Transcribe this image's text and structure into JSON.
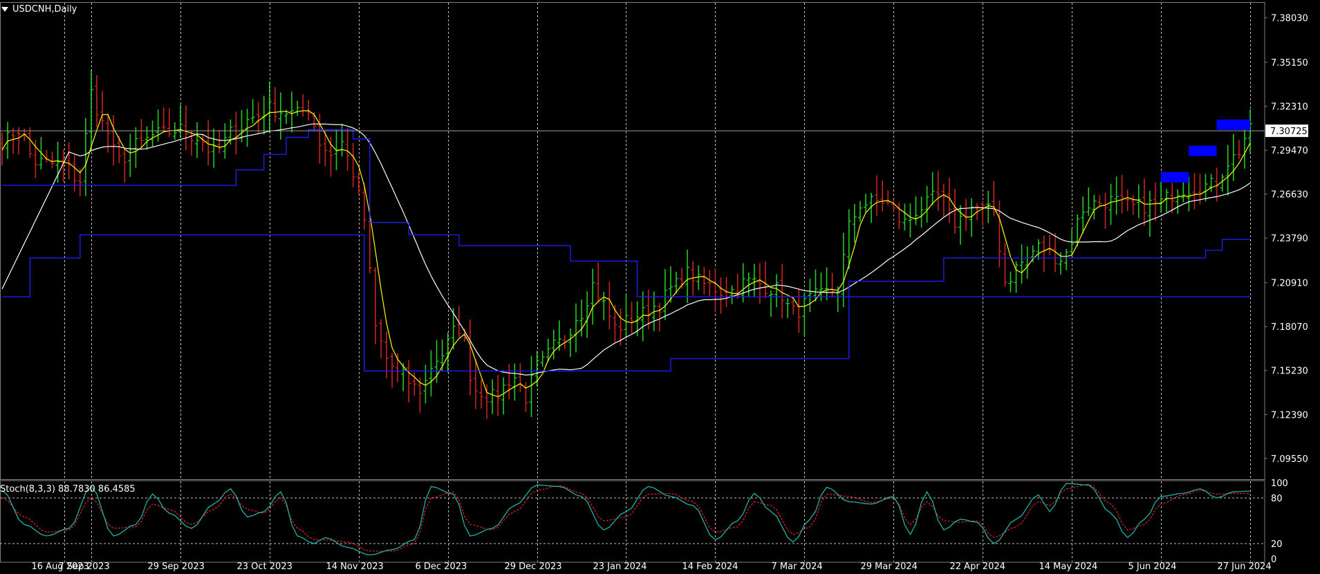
{
  "window": {
    "symbol_title": "USDCNH,Daily",
    "stoch_title": "Stoch(8,3,3) 88.7830 86.4585"
  },
  "colors": {
    "background": "#000000",
    "bull_candle": "#22cc22",
    "bear_candle": "#cc2222",
    "fast_ma": "#ffff00",
    "slow_ma": "#ffffff",
    "channel": "#1e1ef0",
    "blocks": "#0000ff",
    "stoch_main": "#20b2aa",
    "stoch_signal": "#ff2020",
    "grid": "#c0c0c0"
  },
  "chart_data": [
    {
      "type": "candlestick",
      "title": "USDCNH,Daily",
      "ylim": [
        7.082,
        7.39
      ],
      "price_ticks": [
        "7.38030",
        "7.35150",
        "7.32310",
        "7.29470",
        "7.26630",
        "7.23790",
        "7.20910",
        "7.18070",
        "7.15230",
        "7.12390",
        "7.09550"
      ],
      "current_price": "7.30725",
      "x_tick_labels": [
        "16 Aug 2023",
        "7 Sep 2023",
        "29 Sep 2023",
        "23 Oct 2023",
        "14 Nov 2023",
        "6 Dec 2023",
        "29 Dec 2023",
        "23 Jan 2024",
        "14 Feb 2024",
        "7 Mar 2024",
        "29 Mar 2024",
        "22 Apr 2024",
        "14 May 2024",
        "5 Jun 2024",
        "27 Jun 2024"
      ],
      "x_tick_bars": [
        0,
        16,
        32,
        48,
        64,
        80,
        96,
        112,
        128,
        144,
        160,
        176,
        192,
        208,
        224
      ],
      "bar_count": 225,
      "close_anchors": [
        [
          0,
          7.3
        ],
        [
          3,
          7.308
        ],
        [
          6,
          7.287
        ],
        [
          11,
          7.285
        ],
        [
          14,
          7.275
        ],
        [
          16,
          7.332
        ],
        [
          18,
          7.312
        ],
        [
          21,
          7.288
        ],
        [
          24,
          7.298
        ],
        [
          28,
          7.305
        ],
        [
          32,
          7.308
        ],
        [
          35,
          7.303
        ],
        [
          38,
          7.293
        ],
        [
          42,
          7.308
        ],
        [
          45,
          7.316
        ],
        [
          48,
          7.322
        ],
        [
          50,
          7.32
        ],
        [
          53,
          7.318
        ],
        [
          55,
          7.322
        ],
        [
          57,
          7.3
        ],
        [
          59,
          7.292
        ],
        [
          61,
          7.3
        ],
        [
          63,
          7.28
        ],
        [
          65,
          7.25
        ],
        [
          67,
          7.18
        ],
        [
          69,
          7.16
        ],
        [
          71,
          7.15
        ],
        [
          75,
          7.14
        ],
        [
          78,
          7.16
        ],
        [
          82,
          7.18
        ],
        [
          85,
          7.14
        ],
        [
          88,
          7.135
        ],
        [
          92,
          7.148
        ],
        [
          94,
          7.135
        ],
        [
          96,
          7.155
        ],
        [
          100,
          7.17
        ],
        [
          104,
          7.19
        ],
        [
          106,
          7.208
        ],
        [
          108,
          7.195
        ],
        [
          110,
          7.18
        ],
        [
          114,
          7.188
        ],
        [
          118,
          7.195
        ],
        [
          120,
          7.205
        ],
        [
          123,
          7.215
        ],
        [
          126,
          7.208
        ],
        [
          130,
          7.203
        ],
        [
          134,
          7.21
        ],
        [
          139,
          7.205
        ],
        [
          142,
          7.19
        ],
        [
          146,
          7.2
        ],
        [
          150,
          7.205
        ],
        [
          152,
          7.245
        ],
        [
          154,
          7.26
        ],
        [
          158,
          7.262
        ],
        [
          162,
          7.248
        ],
        [
          165,
          7.258
        ],
        [
          168,
          7.265
        ],
        [
          171,
          7.248
        ],
        [
          174,
          7.258
        ],
        [
          178,
          7.255
        ],
        [
          180,
          7.21
        ],
        [
          183,
          7.222
        ],
        [
          186,
          7.232
        ],
        [
          190,
          7.225
        ],
        [
          195,
          7.26
        ],
        [
          199,
          7.262
        ],
        [
          203,
          7.258
        ],
        [
          207,
          7.26
        ],
        [
          212,
          7.27
        ],
        [
          217,
          7.272
        ],
        [
          221,
          7.29
        ],
        [
          224,
          7.307
        ]
      ],
      "channel_upper_steps": [
        [
          0,
          7.272
        ],
        [
          42,
          7.282
        ],
        [
          47,
          7.292
        ],
        [
          51,
          7.303
        ],
        [
          55,
          7.308
        ],
        [
          63,
          7.302
        ],
        [
          66,
          7.248
        ],
        [
          73,
          7.24
        ],
        [
          82,
          7.233
        ],
        [
          102,
          7.223
        ],
        [
          114,
          7.2
        ],
        [
          224,
          7.2
        ]
      ],
      "channel_lower_steps": [
        [
          0,
          7.2
        ],
        [
          5,
          7.225
        ],
        [
          14,
          7.24
        ],
        [
          65,
          7.152
        ],
        [
          120,
          7.16
        ],
        [
          148,
          7.16
        ],
        [
          152,
          7.21
        ],
        [
          166,
          7.21
        ],
        [
          169,
          7.225
        ],
        [
          210,
          7.225
        ],
        [
          216,
          7.23
        ],
        [
          219,
          7.237
        ]
      ],
      "blocks": [
        [
          208,
          213,
          7.277
        ],
        [
          213,
          218,
          7.294
        ],
        [
          218,
          224,
          7.311
        ]
      ]
    },
    {
      "type": "line",
      "title": "Stoch(8,3,3) 88.7830 86.4585",
      "ylim": [
        0,
        100
      ],
      "y_ticks": [
        "100",
        "80",
        "20",
        "0"
      ],
      "series": [
        {
          "key": "main",
          "anchors": [
            [
              0,
              90
            ],
            [
              4,
              45
            ],
            [
              8,
              30
            ],
            [
              12,
              40
            ],
            [
              16,
              95
            ],
            [
              20,
              30
            ],
            [
              24,
              45
            ],
            [
              27,
              85
            ],
            [
              30,
              60
            ],
            [
              34,
              40
            ],
            [
              38,
              72
            ],
            [
              41,
              92
            ],
            [
              44,
              55
            ],
            [
              47,
              62
            ],
            [
              50,
              88
            ],
            [
              53,
              30
            ],
            [
              56,
              20
            ],
            [
              58,
              28
            ],
            [
              62,
              15
            ],
            [
              66,
              5
            ],
            [
              70,
              12
            ],
            [
              74,
              25
            ],
            [
              77,
              95
            ],
            [
              81,
              85
            ],
            [
              84,
              30
            ],
            [
              88,
              40
            ],
            [
              92,
              70
            ],
            [
              96,
              97
            ],
            [
              100,
              95
            ],
            [
              104,
              82
            ],
            [
              108,
              38
            ],
            [
              112,
              62
            ],
            [
              116,
              95
            ],
            [
              120,
              82
            ],
            [
              124,
              70
            ],
            [
              128,
              25
            ],
            [
              132,
              50
            ],
            [
              135,
              86
            ],
            [
              138,
              62
            ],
            [
              142,
              22
            ],
            [
              145,
              52
            ],
            [
              148,
              94
            ],
            [
              152,
              75
            ],
            [
              156,
              72
            ],
            [
              160,
              82
            ],
            [
              163,
              32
            ],
            [
              166,
              88
            ],
            [
              169,
              38
            ],
            [
              172,
              52
            ],
            [
              175,
              48
            ],
            [
              178,
              20
            ],
            [
              182,
              52
            ],
            [
              186,
              84
            ],
            [
              188,
              62
            ],
            [
              191,
              99
            ],
            [
              195,
              97
            ],
            [
              199,
              60
            ],
            [
              202,
              28
            ],
            [
              205,
              52
            ],
            [
              208,
              82
            ],
            [
              212,
              86
            ],
            [
              215,
              92
            ],
            [
              218,
              80
            ],
            [
              221,
              88
            ],
            [
              224,
              89
            ]
          ]
        },
        {
          "key": "signal",
          "anchors": [
            [
              0,
              80
            ],
            [
              4,
              55
            ],
            [
              8,
              35
            ],
            [
              12,
              38
            ],
            [
              16,
              80
            ],
            [
              20,
              40
            ],
            [
              24,
              42
            ],
            [
              27,
              72
            ],
            [
              30,
              65
            ],
            [
              34,
              45
            ],
            [
              38,
              65
            ],
            [
              41,
              85
            ],
            [
              44,
              65
            ],
            [
              47,
              60
            ],
            [
              50,
              80
            ],
            [
              53,
              40
            ],
            [
              56,
              25
            ],
            [
              58,
              25
            ],
            [
              62,
              22
            ],
            [
              66,
              10
            ],
            [
              70,
              10
            ],
            [
              74,
              20
            ],
            [
              77,
              80
            ],
            [
              81,
              88
            ],
            [
              84,
              45
            ],
            [
              88,
              38
            ],
            [
              92,
              62
            ],
            [
              96,
              90
            ],
            [
              100,
              96
            ],
            [
              104,
              86
            ],
            [
              108,
              50
            ],
            [
              112,
              55
            ],
            [
              116,
              85
            ],
            [
              120,
              86
            ],
            [
              124,
              75
            ],
            [
              128,
              35
            ],
            [
              132,
              42
            ],
            [
              135,
              75
            ],
            [
              138,
              70
            ],
            [
              142,
              32
            ],
            [
              145,
              42
            ],
            [
              148,
              85
            ],
            [
              152,
              82
            ],
            [
              156,
              74
            ],
            [
              160,
              80
            ],
            [
              163,
              45
            ],
            [
              166,
              75
            ],
            [
              169,
              50
            ],
            [
              172,
              48
            ],
            [
              175,
              50
            ],
            [
              178,
              28
            ],
            [
              182,
              42
            ],
            [
              186,
              75
            ],
            [
              188,
              70
            ],
            [
              191,
              92
            ],
            [
              195,
              98
            ],
            [
              199,
              72
            ],
            [
              202,
              38
            ],
            [
              205,
              45
            ],
            [
              208,
              72
            ],
            [
              212,
              84
            ],
            [
              215,
              90
            ],
            [
              218,
              85
            ],
            [
              221,
              86
            ],
            [
              224,
              86
            ]
          ]
        }
      ]
    }
  ]
}
